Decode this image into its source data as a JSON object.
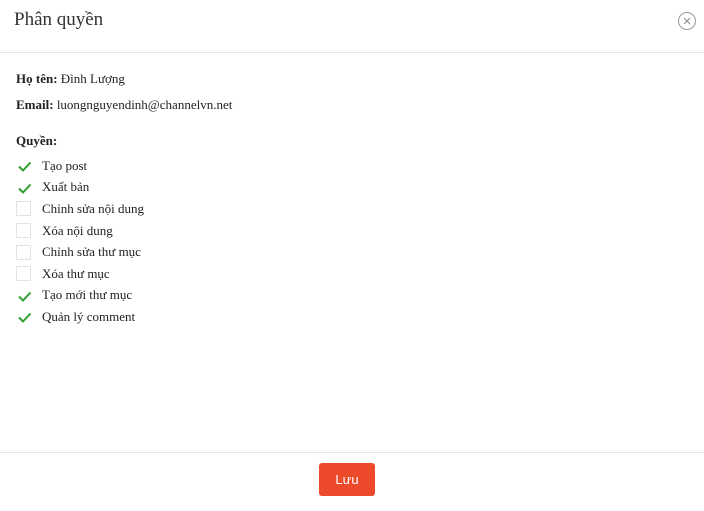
{
  "dialog": {
    "title": "Phân quyền"
  },
  "user": {
    "name_label": "Họ tên:",
    "name_value": "Đình Lượng",
    "email_label": "Email:",
    "email_value": "luongnguyendinh@channelvn.net"
  },
  "permissions": {
    "title": "Quyền:",
    "items": [
      {
        "label": "Tạo post",
        "checked": true
      },
      {
        "label": "Xuất bản",
        "checked": true
      },
      {
        "label": "Chỉnh sửa nội dung",
        "checked": false
      },
      {
        "label": "Xóa nội dung",
        "checked": false
      },
      {
        "label": "Chỉnh sửa thư mục",
        "checked": false
      },
      {
        "label": "Xóa thư mục",
        "checked": false
      },
      {
        "label": "Tạo mới thư mục",
        "checked": true
      },
      {
        "label": "Quản lý comment",
        "checked": true
      }
    ]
  },
  "footer": {
    "save_label": "Lưu"
  },
  "colors": {
    "accent": "#ec4a2a",
    "check": "#2e9e2e"
  },
  "icons": {
    "close": "close-icon",
    "check": "check-icon"
  }
}
